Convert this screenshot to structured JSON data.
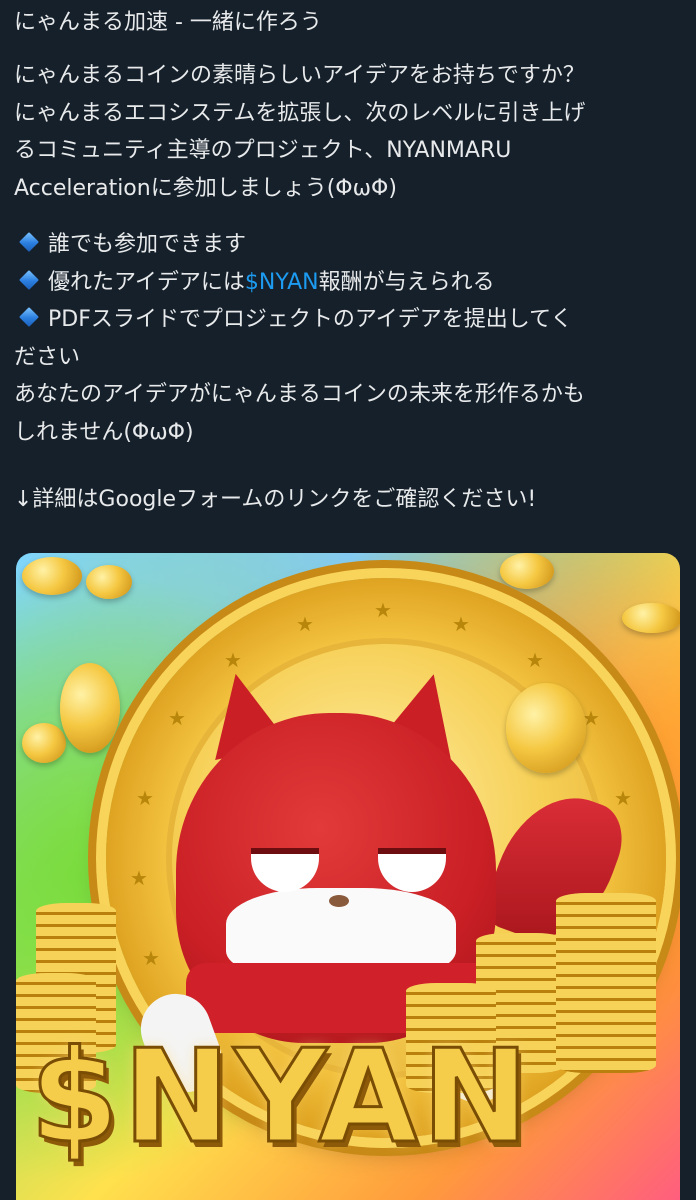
{
  "post": {
    "title": "にゃんまる加速 - 一緒に作ろう",
    "intro_lines": [
      "にゃんまるコインの素晴らしいアイデアをお持ちですか？",
      "にゃんまるエコシステムを拡張し、次のレベルに引き上げ",
      "るコミュニティ主導のプロジェクト、NYANMARU",
      "Accelerationに参加しましょう(ΦωΦ)"
    ],
    "bullets": [
      {
        "text": "誰でも参加できます"
      },
      {
        "text_before": "優れたアイデアには",
        "cashtag": "$NYAN",
        "text_after": "報酬が与えられる"
      },
      {
        "text": "PDFスライドでプロジェクトのアイデアを提出してく"
      }
    ],
    "continuation_lines": [
      "ださい",
      "あなたのアイデアがにゃんまるコインの未来を形作るかも",
      "しれません(ΦωΦ)"
    ],
    "details_line": "↓詳細はGoogleフォームのリンクをご確認ください!",
    "bullet_icon": "small-blue-diamond-icon"
  },
  "media": {
    "logo_text": "$NYAN",
    "colors": {
      "cashtag": "#1d9bf0",
      "background": "#15202b",
      "text": "#e7e9ea",
      "gold": "#f6cd4b",
      "mascot_red": "#c91f25"
    }
  }
}
